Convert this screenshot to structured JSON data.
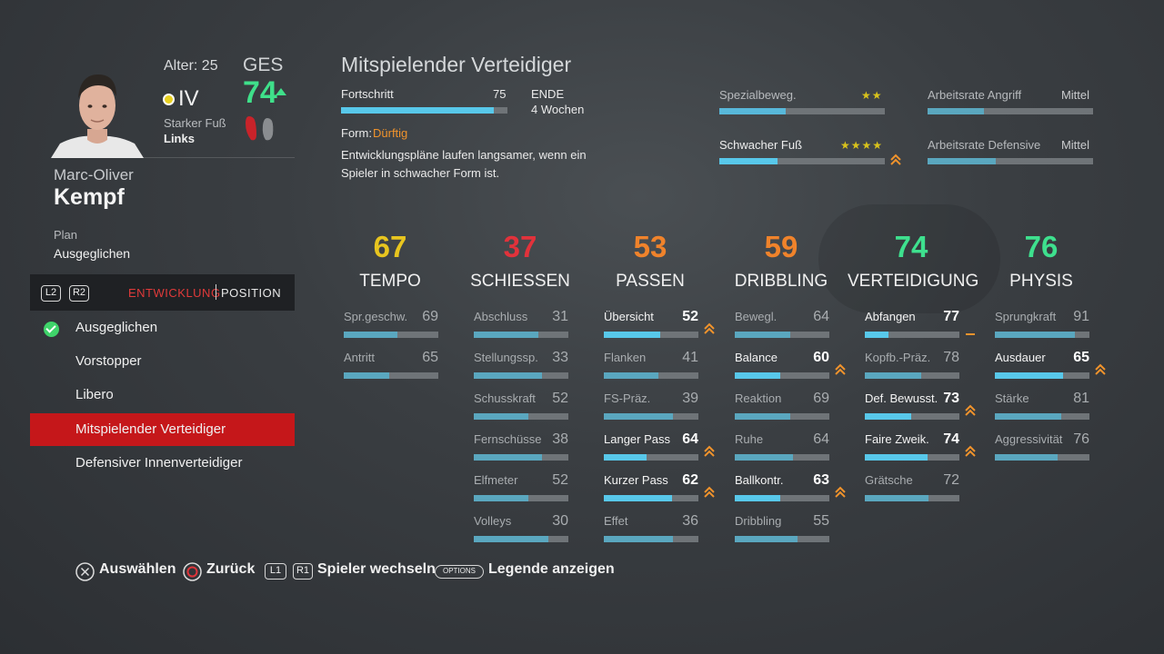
{
  "player": {
    "age_label": "Alter: 25",
    "position": "IV",
    "foot_label": "Starker Fuß",
    "foot_value": "Links",
    "ges_label": "GES",
    "ges_value": "74",
    "first_name": "Marc-Oliver",
    "last_name": "Kempf",
    "plan_label": "Plan",
    "plan_value": "Ausgeglichen"
  },
  "tabs": {
    "l2": "L2",
    "r2": "R2",
    "development": "ENTWICKLUNG",
    "position": "POSITION"
  },
  "plans": [
    {
      "label": "Ausgeglichen",
      "checked": true,
      "selected": false
    },
    {
      "label": "Vorstopper",
      "checked": false,
      "selected": false
    },
    {
      "label": "Libero",
      "checked": false,
      "selected": false
    },
    {
      "label": "Mitspielender Verteidiger",
      "checked": false,
      "selected": true
    },
    {
      "label": "Defensiver Innenverteidiger",
      "checked": false,
      "selected": false
    }
  ],
  "development": {
    "title": "Mitspielender Verteidiger",
    "progress_label": "Fortschritt",
    "progress_value": "75",
    "progress_fraction": 0.92,
    "end_label": "ENDE",
    "end_value": "4 Wochen",
    "form_label": "Form:",
    "form_value": "Dürftig",
    "form_description": "Entwicklungspläne laufen langsamer, wenn ein Spieler in schwacher Form ist."
  },
  "misc": {
    "skill_moves": {
      "label": "Spezialbeweg.",
      "stars": "★★",
      "fraction": 0.4
    },
    "weak_foot": {
      "label": "Schwacher Fuß",
      "stars": "★★★★",
      "fraction": 0.35
    },
    "attack_workrate": {
      "label": "Arbeitsrate Angriff",
      "value": "Mittel",
      "fraction": 0.34
    },
    "defense_workrate": {
      "label": "Arbeitsrate Defensive",
      "value": "Mittel",
      "fraction": 0.41
    }
  },
  "categories": [
    {
      "name": "TEMPO",
      "value": "67",
      "color": "#e8c51f",
      "stats": [
        {
          "name": "Spr.geschw.",
          "value": "69",
          "bright": false,
          "fraction": 0.57,
          "fill": "#5aa7bf"
        },
        {
          "name": "Antritt",
          "value": "65",
          "bright": false,
          "fraction": 0.48,
          "fill": "#5aa7bf"
        }
      ]
    },
    {
      "name": "SCHIESSEN",
      "value": "37",
      "color": "#e2323b",
      "stats": [
        {
          "name": "Abschluss",
          "value": "31",
          "bright": false,
          "fraction": 0.68,
          "fill": "#5aa7bf"
        },
        {
          "name": "Stellungssp.",
          "value": "33",
          "bright": false,
          "fraction": 0.72,
          "fill": "#5aa7bf"
        },
        {
          "name": "Schusskraft",
          "value": "52",
          "bright": false,
          "fraction": 0.58,
          "fill": "#5aa7bf"
        },
        {
          "name": "Fernschüsse",
          "value": "38",
          "bright": false,
          "fraction": 0.72,
          "fill": "#5aa7bf"
        },
        {
          "name": "Elfmeter",
          "value": "52",
          "bright": false,
          "fraction": 0.58,
          "fill": "#5aa7bf"
        },
        {
          "name": "Volleys",
          "value": "30",
          "bright": false,
          "fraction": 0.79,
          "fill": "#5aa7bf"
        }
      ]
    },
    {
      "name": "PASSEN",
      "value": "53",
      "color": "#f0832b",
      "stats": [
        {
          "name": "Übersicht",
          "value": "52",
          "bright": true,
          "fraction": 0.6,
          "fill": "#58c8ea",
          "arrow": true
        },
        {
          "name": "Flanken",
          "value": "41",
          "bright": false,
          "fraction": 0.58,
          "fill": "#5aa7bf"
        },
        {
          "name": "FS-Präz.",
          "value": "39",
          "bright": false,
          "fraction": 0.73,
          "fill": "#5aa7bf"
        },
        {
          "name": "Langer Pass",
          "value": "64",
          "bright": true,
          "fraction": 0.45,
          "fill": "#58c8ea",
          "arrow": true
        },
        {
          "name": "Kurzer Pass",
          "value": "62",
          "bright": true,
          "fraction": 0.72,
          "fill": "#58c8ea",
          "arrow": true
        },
        {
          "name": "Effet",
          "value": "36",
          "bright": false,
          "fraction": 0.73,
          "fill": "#5aa7bf"
        }
      ]
    },
    {
      "name": "DRIBBLING",
      "value": "59",
      "color": "#f0832b",
      "stats": [
        {
          "name": "Bewegl.",
          "value": "64",
          "bright": false,
          "fraction": 0.59,
          "fill": "#5aa7bf"
        },
        {
          "name": "Balance",
          "value": "60",
          "bright": true,
          "fraction": 0.48,
          "fill": "#58c8ea",
          "arrow": true
        },
        {
          "name": "Reaktion",
          "value": "69",
          "bright": false,
          "fraction": 0.59,
          "fill": "#5aa7bf"
        },
        {
          "name": "Ruhe",
          "value": "64",
          "bright": false,
          "fraction": 0.62,
          "fill": "#5aa7bf"
        },
        {
          "name": "Ballkontr.",
          "value": "63",
          "bright": true,
          "fraction": 0.48,
          "fill": "#58c8ea",
          "arrow": true
        },
        {
          "name": "Dribbling",
          "value": "55",
          "bright": false,
          "fraction": 0.66,
          "fill": "#5aa7bf"
        }
      ]
    },
    {
      "name": "VERTEIDIGUNG",
      "value": "74",
      "color": "#3ee08e",
      "stats": [
        {
          "name": "Abfangen",
          "value": "77",
          "bright": true,
          "fraction": 0.25,
          "fill": "#58c8ea",
          "dash": true
        },
        {
          "name": "Kopfb.-Präz.",
          "value": "78",
          "bright": false,
          "fraction": 0.6,
          "fill": "#5aa7bf"
        },
        {
          "name": "Def. Bewusst.",
          "value": "73",
          "bright": true,
          "fraction": 0.49,
          "fill": "#58c8ea",
          "arrow": true
        },
        {
          "name": "Faire Zweik.",
          "value": "74",
          "bright": true,
          "fraction": 0.66,
          "fill": "#58c8ea",
          "arrow": true
        },
        {
          "name": "Grätsche",
          "value": "72",
          "bright": false,
          "fraction": 0.67,
          "fill": "#5aa7bf"
        }
      ]
    },
    {
      "name": "PHYSIS",
      "value": "76",
      "color": "#3ee08e",
      "stats": [
        {
          "name": "Sprungkraft",
          "value": "91",
          "bright": false,
          "fraction": 0.85,
          "fill": "#5aa7bf"
        },
        {
          "name": "Ausdauer",
          "value": "65",
          "bright": true,
          "fraction": 0.72,
          "fill": "#58c8ea",
          "arrow": true
        },
        {
          "name": "Stärke",
          "value": "81",
          "bright": false,
          "fraction": 0.7,
          "fill": "#5aa7bf"
        },
        {
          "name": "Aggressivität",
          "value": "76",
          "bright": false,
          "fraction": 0.66,
          "fill": "#5aa7bf"
        }
      ]
    }
  ],
  "footer": {
    "select": "Auswählen",
    "back": "Zurück",
    "l1": "L1",
    "r1": "R1",
    "switch_player": "Spieler wechseln",
    "options": "OPTIONS",
    "legend": "Legende anzeigen"
  },
  "colors": {
    "accent_red": "#c5171a",
    "bar_track": "#6f7478",
    "bar_bright": "#58c8ea",
    "upgrade_arrow": "#f0932c"
  }
}
